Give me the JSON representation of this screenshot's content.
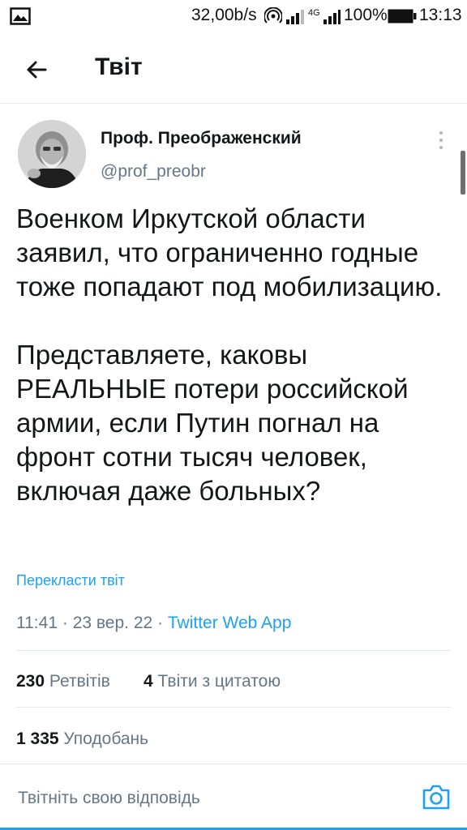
{
  "status_bar": {
    "speed": "32,00b/s",
    "network": "4G",
    "battery": "100%",
    "time": "13:13"
  },
  "header": {
    "title": "Твіт"
  },
  "tweet": {
    "author_name": "Проф. Преображенский",
    "author_handle": "@prof_preobr",
    "paragraphs": [
      "Военком Иркутской области заявил, что ограниченно годные тоже попадают под мобилизацию.",
      "Представляете, каковы РЕАЛЬНЫЕ потери российской армии, если Путин погнал на фронт сотни тысяч человек, включая даже больных?"
    ],
    "translate_label": "Перекласти твіт",
    "time": "11:41",
    "date": "23 вер. 22",
    "separator": "·",
    "source": "Twitter Web App"
  },
  "stats": {
    "retweets_count": "230",
    "retweets_label": "Ретвітів",
    "quotes_count": "4",
    "quotes_label": "Твіти з цитатою",
    "likes_count": "1 335",
    "likes_label": "Уподобань"
  },
  "reply": {
    "placeholder": "Твітніть свою відповідь"
  },
  "colors": {
    "accent": "#1da1f2",
    "secondary_text": "#657786",
    "divider": "#e1e8ed"
  }
}
